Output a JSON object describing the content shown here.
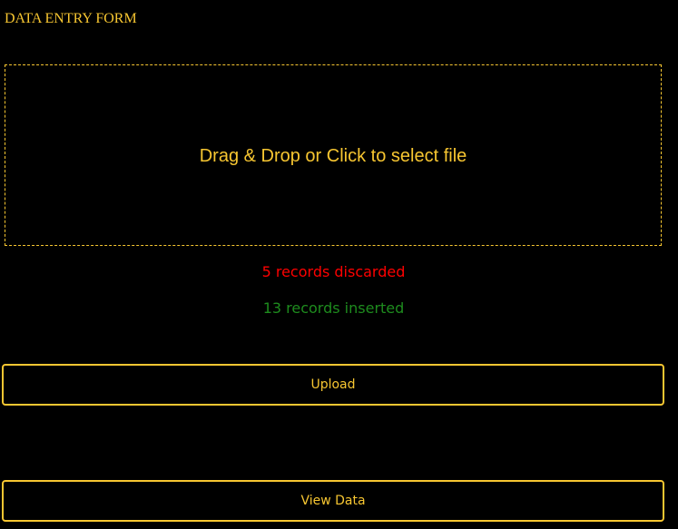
{
  "form": {
    "title": "DATA ENTRY FORM"
  },
  "dropzone": {
    "label": "Drag & Drop or Click to select file"
  },
  "status": {
    "discarded": "5 records discarded",
    "inserted": "13 records inserted"
  },
  "buttons": {
    "upload_label": "Upload",
    "view_data_label": "View Data"
  },
  "colors": {
    "background": "#000000",
    "accent": "#f7c631",
    "error": "#ff0000",
    "success": "#1e8c1e"
  }
}
